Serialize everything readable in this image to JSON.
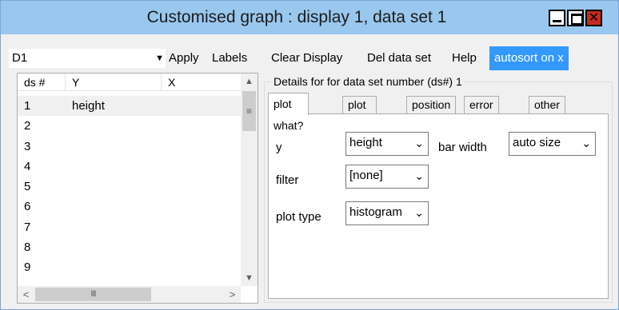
{
  "window": {
    "title": "Customised graph : display 1, data set 1",
    "close_glyph": "✕"
  },
  "menubar": {
    "display_select": "D1",
    "items": [
      "Apply",
      "Labels",
      "Clear Display",
      "Del data set",
      "Help",
      "autosort on x"
    ]
  },
  "datasets": {
    "headers": [
      "ds #",
      "Y",
      "X"
    ],
    "rows": [
      {
        "ds": "1",
        "y": "height",
        "x": ""
      },
      {
        "ds": "2",
        "y": "",
        "x": ""
      },
      {
        "ds": "3",
        "y": "",
        "x": ""
      },
      {
        "ds": "4",
        "y": "",
        "x": ""
      },
      {
        "ds": "5",
        "y": "",
        "x": ""
      },
      {
        "ds": "6",
        "y": "",
        "x": ""
      },
      {
        "ds": "7",
        "y": "",
        "x": ""
      },
      {
        "ds": "8",
        "y": "",
        "x": ""
      },
      {
        "ds": "9",
        "y": "",
        "x": ""
      }
    ],
    "scroll_thumb_glyph": "III"
  },
  "details": {
    "group_label": "Details for for data set number (ds#) 1",
    "tabs": [
      "plot what?",
      "plot style",
      "position",
      "error bars",
      "other"
    ],
    "active_tab": "plot what?",
    "fields": {
      "y_label": "y",
      "y_value": "height",
      "bar_width_label": "bar width",
      "bar_width_value": "auto size",
      "filter_label": "filter",
      "filter_value": "[none]",
      "plot_type_label": "plot type",
      "plot_type_value": "histogram"
    }
  },
  "colors": {
    "titlebar": "#99c7ee",
    "accent": "#3399ff",
    "close_button": "#c42b1c"
  }
}
